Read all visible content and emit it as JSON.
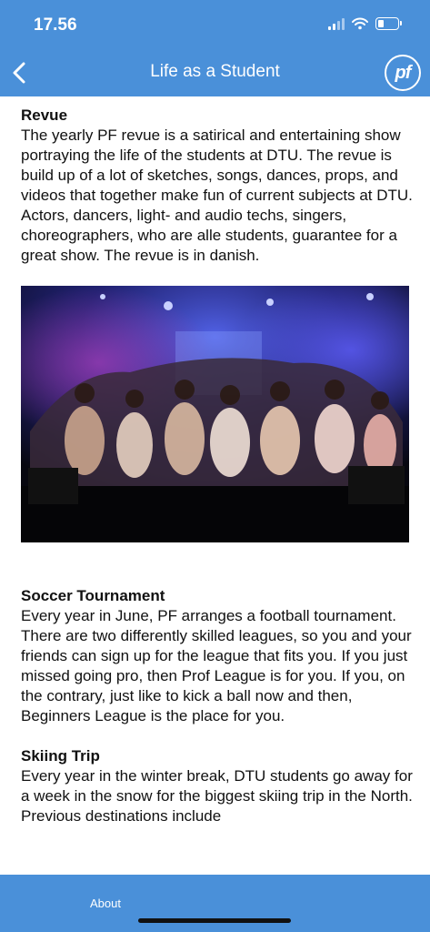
{
  "status": {
    "time": "17.56"
  },
  "nav": {
    "title": "Life as a Student",
    "logo_text": "pf"
  },
  "sections": [
    {
      "title": "Revue",
      "body": "The yearly PF revue is a satirical and entertaining show portraying the life of the students at DTU. The revue is build up of a lot of sketches, songs, dances, props, and videos that together make fun of current subjects at DTU. Actors, dancers, light- and audio techs, singers, choreographers, who are alle students, guarantee for a great show. The revue is in danish."
    },
    {
      "title": "Soccer Tournament",
      "body": "Every year in June, PF arranges a football tournament. There are two differently skilled leagues, so you and your friends can sign up for the league that fits you. If you just missed going pro, then Prof League is for you. If you, on the contrary, just like to kick a ball now and then, Beginners League is the place for you."
    },
    {
      "title": "Skiing Trip",
      "body": "Every year in the winter break, DTU students go away for a week in the snow for the biggest skiing trip in the North. Previous destinations include"
    }
  ],
  "footer": {
    "tab_label": "About"
  },
  "colors": {
    "brand": "#4a90d9",
    "text": "#111111"
  }
}
